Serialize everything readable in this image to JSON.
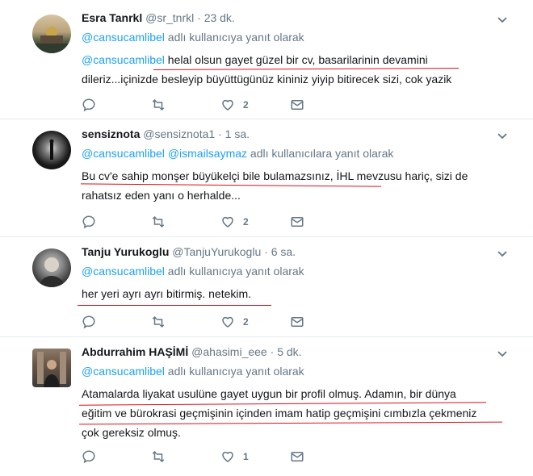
{
  "tweets": [
    {
      "name": "Esra Tanrkl",
      "handle": "@sr_tnrkl",
      "time": "23 dk.",
      "reply_to": [
        "@cansucamlibel"
      ],
      "reply_suffix": " adlı kullanıcıya yanıt olarak",
      "mention": "@cansucamlibel",
      "line1": " helal olsun gayet güzel bir cv, basarilarinin devamini",
      "line2": "dileriz...içinizde besleyip büyüttügünüz kininiz yiyip bitirecek sizi, cok yazik",
      "likes": "2",
      "avatar_colors": [
        "#c8b28a",
        "#3e4a3a"
      ]
    },
    {
      "name": "sensiznota",
      "handle": "@sensiznota1",
      "time": "1 sa.",
      "reply_to": [
        "@cansucamlibel",
        "@ismailsaymaz"
      ],
      "reply_suffix": " adlı kullanıcılara yanıt olarak",
      "line1": "Bu cv'e sahip monşer büyükelçi bile bulamazsınız, İHL mevzusu hariç, sizi de",
      "line2": "rahatsız eden yanı o herhalde...",
      "likes": "2",
      "avatar_colors": [
        "#222222",
        "#cccccc"
      ]
    },
    {
      "name": "Tanju Yurukoglu",
      "handle": "@TanjuYurukoglu",
      "time": "6 sa.",
      "reply_to": [
        "@cansucamlibel"
      ],
      "reply_suffix": " adlı kullanıcıya yanıt olarak",
      "line1": "her yeri ayrı ayrı bitirmiş. netekim.",
      "likes": "2",
      "avatar_colors": [
        "#444444",
        "#999999"
      ]
    },
    {
      "name": "Abdurrahim HAŞİMİ",
      "handle": "@ahasimi_eee",
      "time": "5 dk.",
      "reply_to": [
        "@cansucamlibel"
      ],
      "reply_suffix": " adlı kullanıcıya yanıt olarak",
      "line1": "Atamalarda liyakat usulüne gayet uygun bir profil olmuş. Adamın, bir dünya",
      "line2": "eğitim ve bürokrasi geçmişinin içinden imam hatip geçmişini cımbızla çekmeniz",
      "line3": "çok gereksiz olmuş.",
      "likes": "1",
      "avatar_colors": [
        "#6d5a4a",
        "#2a2a2a"
      ]
    }
  ],
  "icons": [
    "reply-icon",
    "retweet-icon",
    "like-icon",
    "dm-icon",
    "caret-down-icon"
  ],
  "colors": {
    "link": "#1da1f2",
    "muted": "#657786",
    "underline": "#d9111b"
  }
}
